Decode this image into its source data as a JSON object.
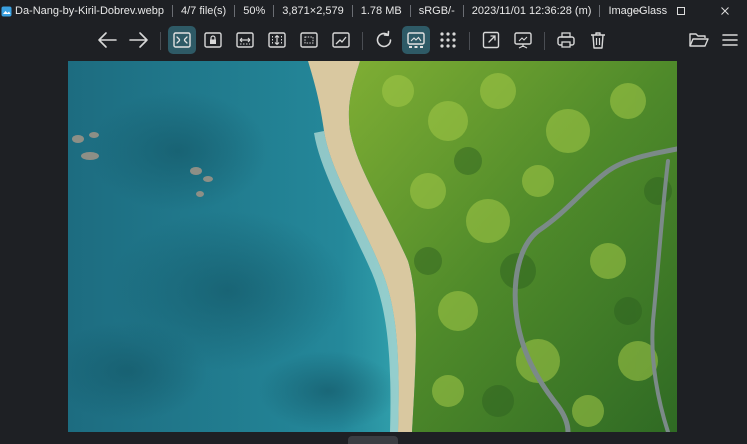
{
  "titlebar": {
    "app_icon": "imageglass-icon",
    "filename": "Da-Nang-by-Kiril-Dobrev.webp",
    "file_index": "4/7 file(s)",
    "zoom": "50%",
    "dimensions": "3,871×2,579",
    "file_size": "1.78 MB",
    "color_profile": "sRGB/-",
    "date": "2023/11/01 12:36:28 (m)",
    "app_name": "ImageGlass"
  },
  "window_controls": [
    "minimize-icon",
    "maximize-icon",
    "close-icon"
  ],
  "toolbar": {
    "buttons": [
      {
        "icon": "arrow-left-icon"
      },
      {
        "icon": "arrow-right-icon"
      },
      {
        "icon": "auto-zoom-icon",
        "active": true
      },
      {
        "icon": "lock-zoom-icon"
      },
      {
        "icon": "scale-to-width-icon"
      },
      {
        "icon": "scale-to-height-icon"
      },
      {
        "icon": "scale-to-fit-icon"
      },
      {
        "icon": "scale-to-fill-icon"
      },
      {
        "icon": "rotate-icon"
      },
      {
        "icon": "gallery-icon",
        "active": true
      },
      {
        "icon": "thumbnail-grid-icon"
      },
      {
        "icon": "fullscreen-icon"
      },
      {
        "icon": "slideshow-icon"
      },
      {
        "icon": "print-icon"
      },
      {
        "icon": "delete-icon"
      },
      {
        "icon": "open-folder-icon"
      },
      {
        "icon": "menu-icon"
      }
    ]
  },
  "viewer": {
    "image": "aerial-coastline-photo"
  },
  "colors": {
    "accent": "#2e5a66",
    "background": "#1e2024",
    "icon": "#d8d8d8"
  }
}
